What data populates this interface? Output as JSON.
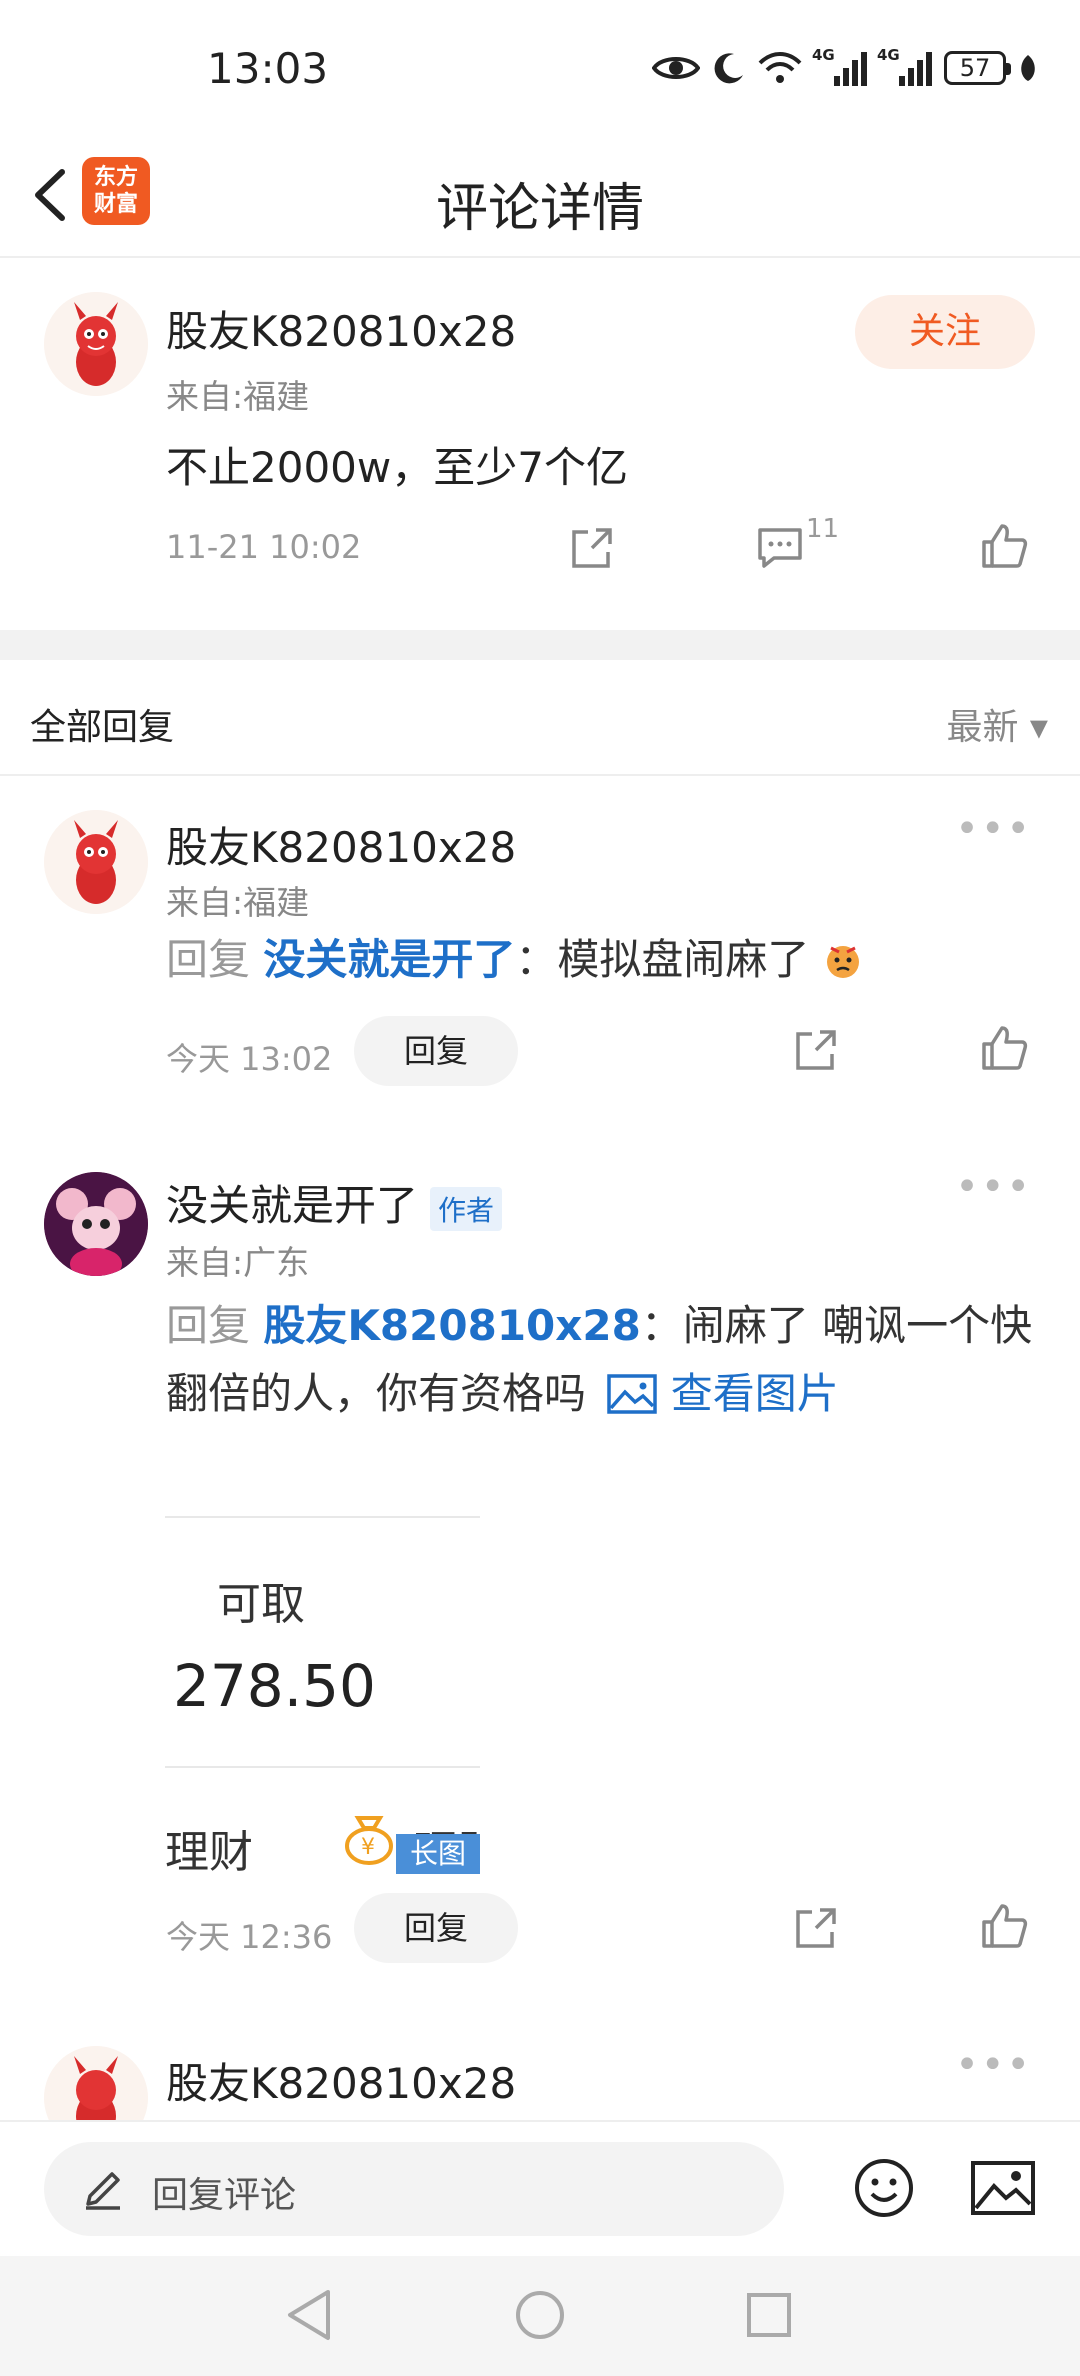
{
  "status_bar": {
    "time": "13:03",
    "battery": "57",
    "net1": "4G",
    "net2": "4G"
  },
  "header": {
    "title": "评论详情",
    "app_logo_line1": "东方",
    "app_logo_line2": "财富"
  },
  "main_comment": {
    "username": "股友K820810x28",
    "location": "来自:福建",
    "follow_label": "关注",
    "text": "不止2000w，至少7个亿",
    "time": "11-21 10:02",
    "reply_count": "11"
  },
  "replies_section": {
    "title": "全部回复",
    "sort_label": "最新 ▾"
  },
  "replies": [
    {
      "username": "股友K820810x28",
      "location": "来自:福建",
      "reply_prefix": "回复",
      "reply_to": "没关就是开了",
      "text": "：模拟盘闹麻了",
      "time": "今天 13:02",
      "reply_button": "回复"
    },
    {
      "username": "没关就是开了",
      "author_tag": "作者",
      "location": "来自:广东",
      "reply_prefix": "回复",
      "reply_to": "股友K820810x28",
      "text_line1": "：闹麻了 嘲讽一个快",
      "text_line2": "翻倍的人，你有资格吗",
      "view_image": "查看图片",
      "time": "今天 12:36",
      "reply_button": "回复"
    },
    {
      "username": "股友K820810x28"
    }
  ],
  "embedded_image": {
    "label_withdrawable": "可取",
    "amount": "278.50",
    "label_finance": "理财",
    "label_finance2": "理财",
    "long_image_badge": "长图"
  },
  "bottom": {
    "input_placeholder": "回复评论"
  },
  "colors": {
    "accent": "#f05a22",
    "link": "#1e6fc8"
  }
}
